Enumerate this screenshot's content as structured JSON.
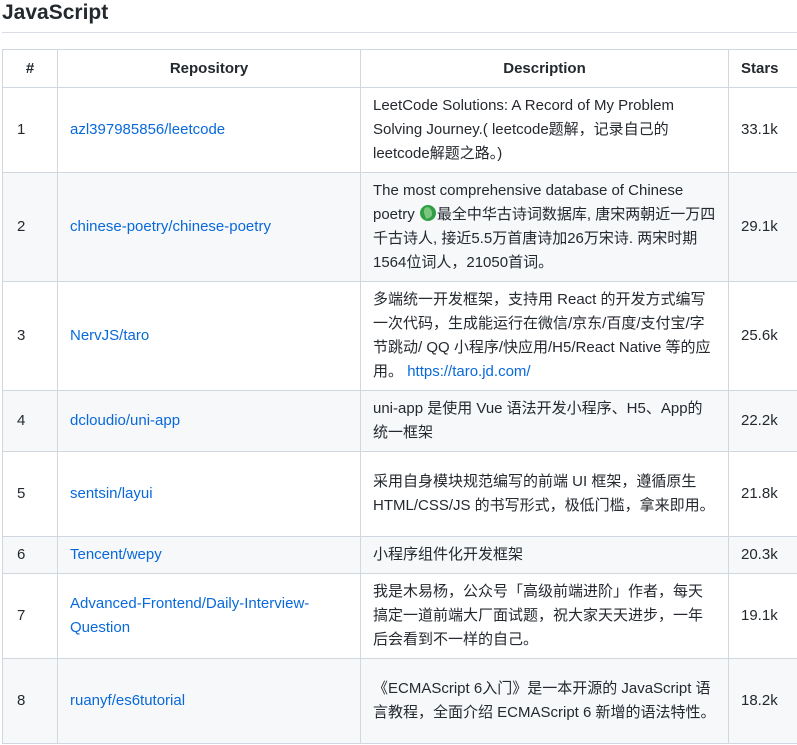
{
  "section": {
    "title": "JavaScript"
  },
  "table": {
    "headers": [
      "#",
      "Repository",
      "Description",
      "Stars"
    ],
    "rows": [
      {
        "num": "1",
        "repo": "azl397985856/leetcode",
        "desc_lines": [
          "LeetCode Solutions: A Record of My Problem",
          "Solving Journey.( leetcode题解，记录自己的",
          "leetcode解题之路。)"
        ],
        "stars": "33.1k"
      },
      {
        "num": "2",
        "repo": "chinese-poetry/chinese-poetry",
        "desc_a": "The most comprehensive database of Chinese poetry",
        "desc_b": "最全中华古诗词数据库, 唐宋两朝近一万四千古诗人, 接近5.5万首唐诗加26万宋诗. 两宋时期1564位词人，21050首词。",
        "stars": "29.1k"
      },
      {
        "num": "3",
        "repo": "NervJS/taro",
        "desc_text": "多端统一开发框架，支持用 React 的开发方式编写一次代码，生成能运行在微信/京东/百度/支付宝/字节跳动/ QQ 小程序/快应用/H5/React Native 等的应用。",
        "desc_link": "https://taro.jd.com/",
        "stars": "25.6k"
      },
      {
        "num": "4",
        "repo": "dcloudio/uni-app",
        "desc": "uni-app 是使用 Vue 语法开发小程序、H5、App的统一框架",
        "stars": "22.2k"
      },
      {
        "num": "5",
        "repo": "sentsin/layui",
        "desc": "采用自身模块规范编写的前端 UI 框架，遵循原生 HTML/CSS/JS 的书写形式，极低门槛，拿来即用。",
        "stars": "21.8k"
      },
      {
        "num": "6",
        "repo": "Tencent/wepy",
        "desc": "小程序组件化开发框架",
        "stars": "20.3k"
      },
      {
        "num": "7",
        "repo": "Advanced-Frontend/Daily-Interview-Question",
        "desc": "我是木易杨，公众号「高级前端进阶」作者，每天搞定一道前端大厂面试题，祝大家天天进步，一年后会看到不一样的自己。",
        "stars": "19.1k"
      },
      {
        "num": "8",
        "repo": "ruanyf/es6tutorial",
        "desc": "《ECMAScript 6入门》是一本开源的 JavaScript 语言教程，全面介绍 ECMAScript 6 新增的语法特性。",
        "stars": "18.2k"
      }
    ]
  },
  "icons": {
    "poetry_emoji": "herb-icon"
  },
  "colors": {
    "link": "#0969da",
    "alt_row": "#f6f8fa",
    "border": "#d0d7de"
  }
}
